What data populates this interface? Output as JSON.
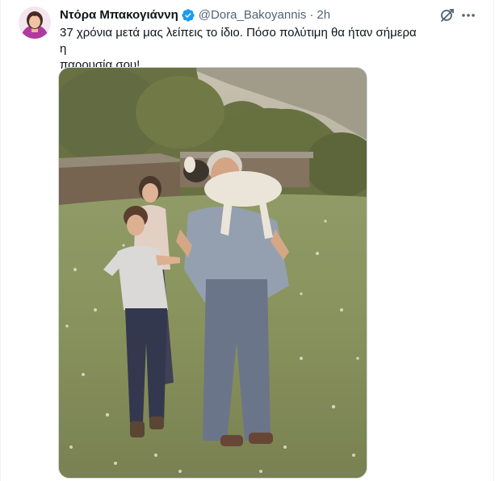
{
  "tweet": {
    "author": {
      "display_name": "Ντόρα Μπακογιάννη",
      "handle": "@Dora_Bakoyannis",
      "verified": true,
      "verified_color": "#1d9bf0"
    },
    "separator": "·",
    "time": "2h",
    "text_lines": [
      "37 χρόνια μετά μας λείπεις το ίδιο. Πόσο πολύτιμη θα ήταν σήμερα η",
      "παρουσία σου!"
    ],
    "media": {
      "type": "photo"
    },
    "actions": {
      "grok_icon": "grok-icon",
      "more_icon": "more-horizontal-icon"
    }
  },
  "colors": {
    "text_primary": "#0f1419",
    "text_secondary": "#536471",
    "border": "#cfd9de"
  }
}
